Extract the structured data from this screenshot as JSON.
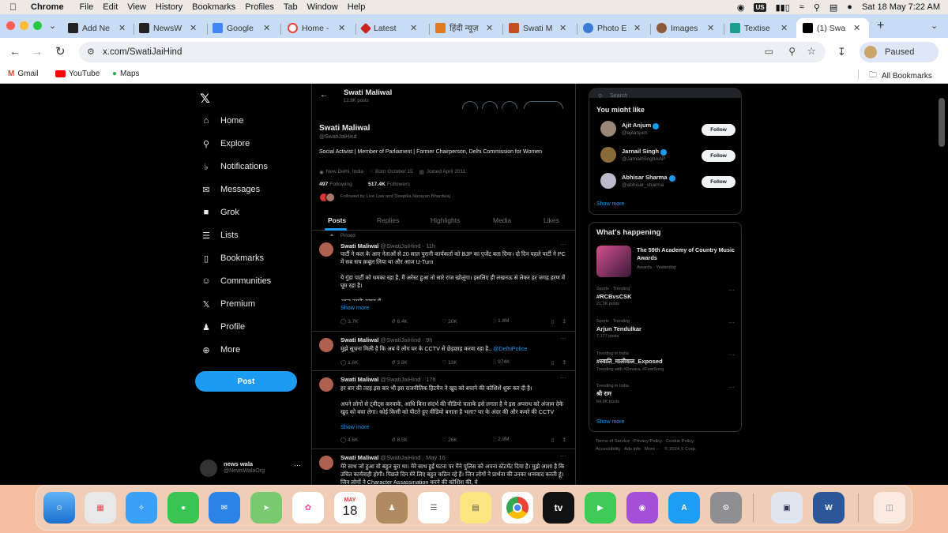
{
  "menubar": {
    "app": "Chrome",
    "items": [
      "File",
      "Edit",
      "View",
      "History",
      "Bookmarks",
      "Profiles",
      "Tab",
      "Window",
      "Help"
    ],
    "input_source": "US",
    "datetime": "Sat 18 May  7:22 AM"
  },
  "tabs": [
    {
      "title": "Add Ne",
      "color": "#222222"
    },
    {
      "title": "NewsW",
      "color": "#222222"
    },
    {
      "title": "Google",
      "color": "#4285f4"
    },
    {
      "title": "Home -",
      "color": "#ea4335"
    },
    {
      "title": "Latest",
      "color": "#cc2222"
    },
    {
      "title": "हिंदी न्यूज़",
      "color": "#e07a1f"
    },
    {
      "title": "Swati M",
      "color": "#c0501f"
    },
    {
      "title": "Photo E",
      "color": "#3a7bd5"
    },
    {
      "title": "Images",
      "color": "#8a5a3a"
    },
    {
      "title": "Textise",
      "color": "#1a9f8f"
    },
    {
      "title": "(1) Swa",
      "color": "#000000"
    }
  ],
  "toolbar": {
    "url": "x.com/SwatiJaiHind",
    "profile_status": "Paused"
  },
  "bookmarks": {
    "items": [
      "Gmail",
      "YouTube",
      "Maps"
    ],
    "all": "All Bookmarks"
  },
  "nav": {
    "items": [
      "Home",
      "Explore",
      "Notifications",
      "Messages",
      "Grok",
      "Lists",
      "Bookmarks",
      "Communities",
      "Premium",
      "Profile",
      "More"
    ],
    "post_label": "Post",
    "account_name": "news wala",
    "account_handle": "@NewsWalaOrg"
  },
  "profile": {
    "header_name": "Swati Maliwal",
    "header_posts": "12.9K posts",
    "name": "Swati Maliwal",
    "handle": "@SwatiJaiHind",
    "bio": "Social Activist | Member of Parliament | Former Chairperson, Delhi Commission for Women",
    "location": "New Delhi, India",
    "born": "Born October 15",
    "joined": "Joined April 2011",
    "following_count": "497",
    "following_label": "Following",
    "followers_count": "517.4K",
    "followers_label": "Followers",
    "followed_by": "Followed by Live Law and Deepika Narayan Bhardwaj",
    "tabs": [
      "Posts",
      "Replies",
      "Highlights",
      "Media",
      "Likes"
    ]
  },
  "tweets": [
    {
      "pinned": "Pinned",
      "name": "Swati Maliwal",
      "meta": "@SwatiJaiHind · 11h",
      "body": "पार्टी ने कल के आए नेताओं से 20 साल पुरानी कार्यकर्ता को BJP का एजेंट बता दिया। दो दिन पहले पार्टी ने PC में सब सच क़बूल लिया था और आज U-Turn\n\nये गुंडा पार्टी को धमका रहा है, मैं अरेस्ट हुआ तो सारे राज खोलूंगा। इसलिए ही लखनऊ से लेकर हर जगह हरण में घूम रहा है।\n\nआज उसके दबाव में",
      "show_more": "Show more",
      "replies": "3.7K",
      "reposts": "6.4K",
      "likes": "20K",
      "views": "1.8M"
    },
    {
      "name": "Swati Maliwal",
      "meta": "@SwatiJaiHind · 9h",
      "body": "मुझे सूचना मिली है कि अब ये लोग घर के CCTV से छेड़छाड़ करवा रहा है..",
      "mention": "@DelhiPolice",
      "replies": "1.6K",
      "reposts": "3.8K",
      "likes": "13K",
      "views": "974K"
    },
    {
      "name": "Swati Maliwal",
      "meta": "@SwatiJaiHind · 17h",
      "body": "हर बार की तरह इस बार भी इस राजनीतिक हिटमैन ने खुद को बचाने की कोशिशें शुरू कर दी है।\n\nअपने लोगों से ट्वीट्स करवाके, आधि बिना संदर्भ की वीडियो चलाके इसे लगता है ये इस अपराध को अंजाम देके खुद को बचा लेगा। कोई किसी को पीटते हुए वीडियो बनाता है भला? घर के अंदर की और कमरे की CCTV",
      "show_more": "Show more",
      "replies": "4.6K",
      "reposts": "8.5K",
      "likes": "26K",
      "views": "2.9M"
    },
    {
      "name": "Swati Maliwal",
      "meta": "@SwatiJaiHind · May 16",
      "body": "मेरे साथ जो हुआ वो बहुत बुरा था। मेरे साथ हुई घटना पर मैंने पुलिस को अपना स्टेटमेंट दिया है। मुझे आशा है कि उचित कार्यवाही होगी। पिछले दिन मेरे लिए बहुत कठिन रहे हैं। जिन लोगों ने प्रार्थना की उनका धन्यवाद करती हूं। जिन लोगों ने Character Assassination करने की कोशिश की, ये"
    }
  ],
  "right": {
    "search_placeholder": "Search",
    "wtf_title": "You might like",
    "suggestions": [
      {
        "name": "Ajit Anjum",
        "handle": "@ajitanjum",
        "button": "Follow"
      },
      {
        "name": "Jarnail Singh",
        "handle": "@JarnailSinghAAP",
        "button": "Follow"
      },
      {
        "name": "Abhisar Sharma",
        "handle": "@abhisar_sharma",
        "button": "Follow"
      }
    ],
    "show_more": "Show more",
    "happening_title": "What's happening",
    "event_title": "The 59th Academy of Country Music Awards",
    "event_meta": "Awards · Yesterday",
    "trends": [
      {
        "context": "Sports · Trending",
        "title": "#RCBvsCSK",
        "posts": "21.1K posts"
      },
      {
        "context": "Sports · Trending",
        "title": "Arjun Tendulkar",
        "posts": "7,177 posts"
      },
      {
        "context": "Trending in India",
        "title": "#स्वाति_मालीवाल_Exposed",
        "posts": "Trending with #Devara, #FearSong"
      },
      {
        "context": "Trending in India",
        "title": "श्री राम",
        "posts": "64.9K posts"
      }
    ],
    "show_more2": "Show more",
    "footer1": "Terms of Service   Privacy Policy   Cookie Policy",
    "footer2": "Accessibility   Ads info   More ···   © 2024 X Corp."
  },
  "dock": {
    "calendar_month": "MAY",
    "calendar_day": "18",
    "tv_label": "tv"
  }
}
